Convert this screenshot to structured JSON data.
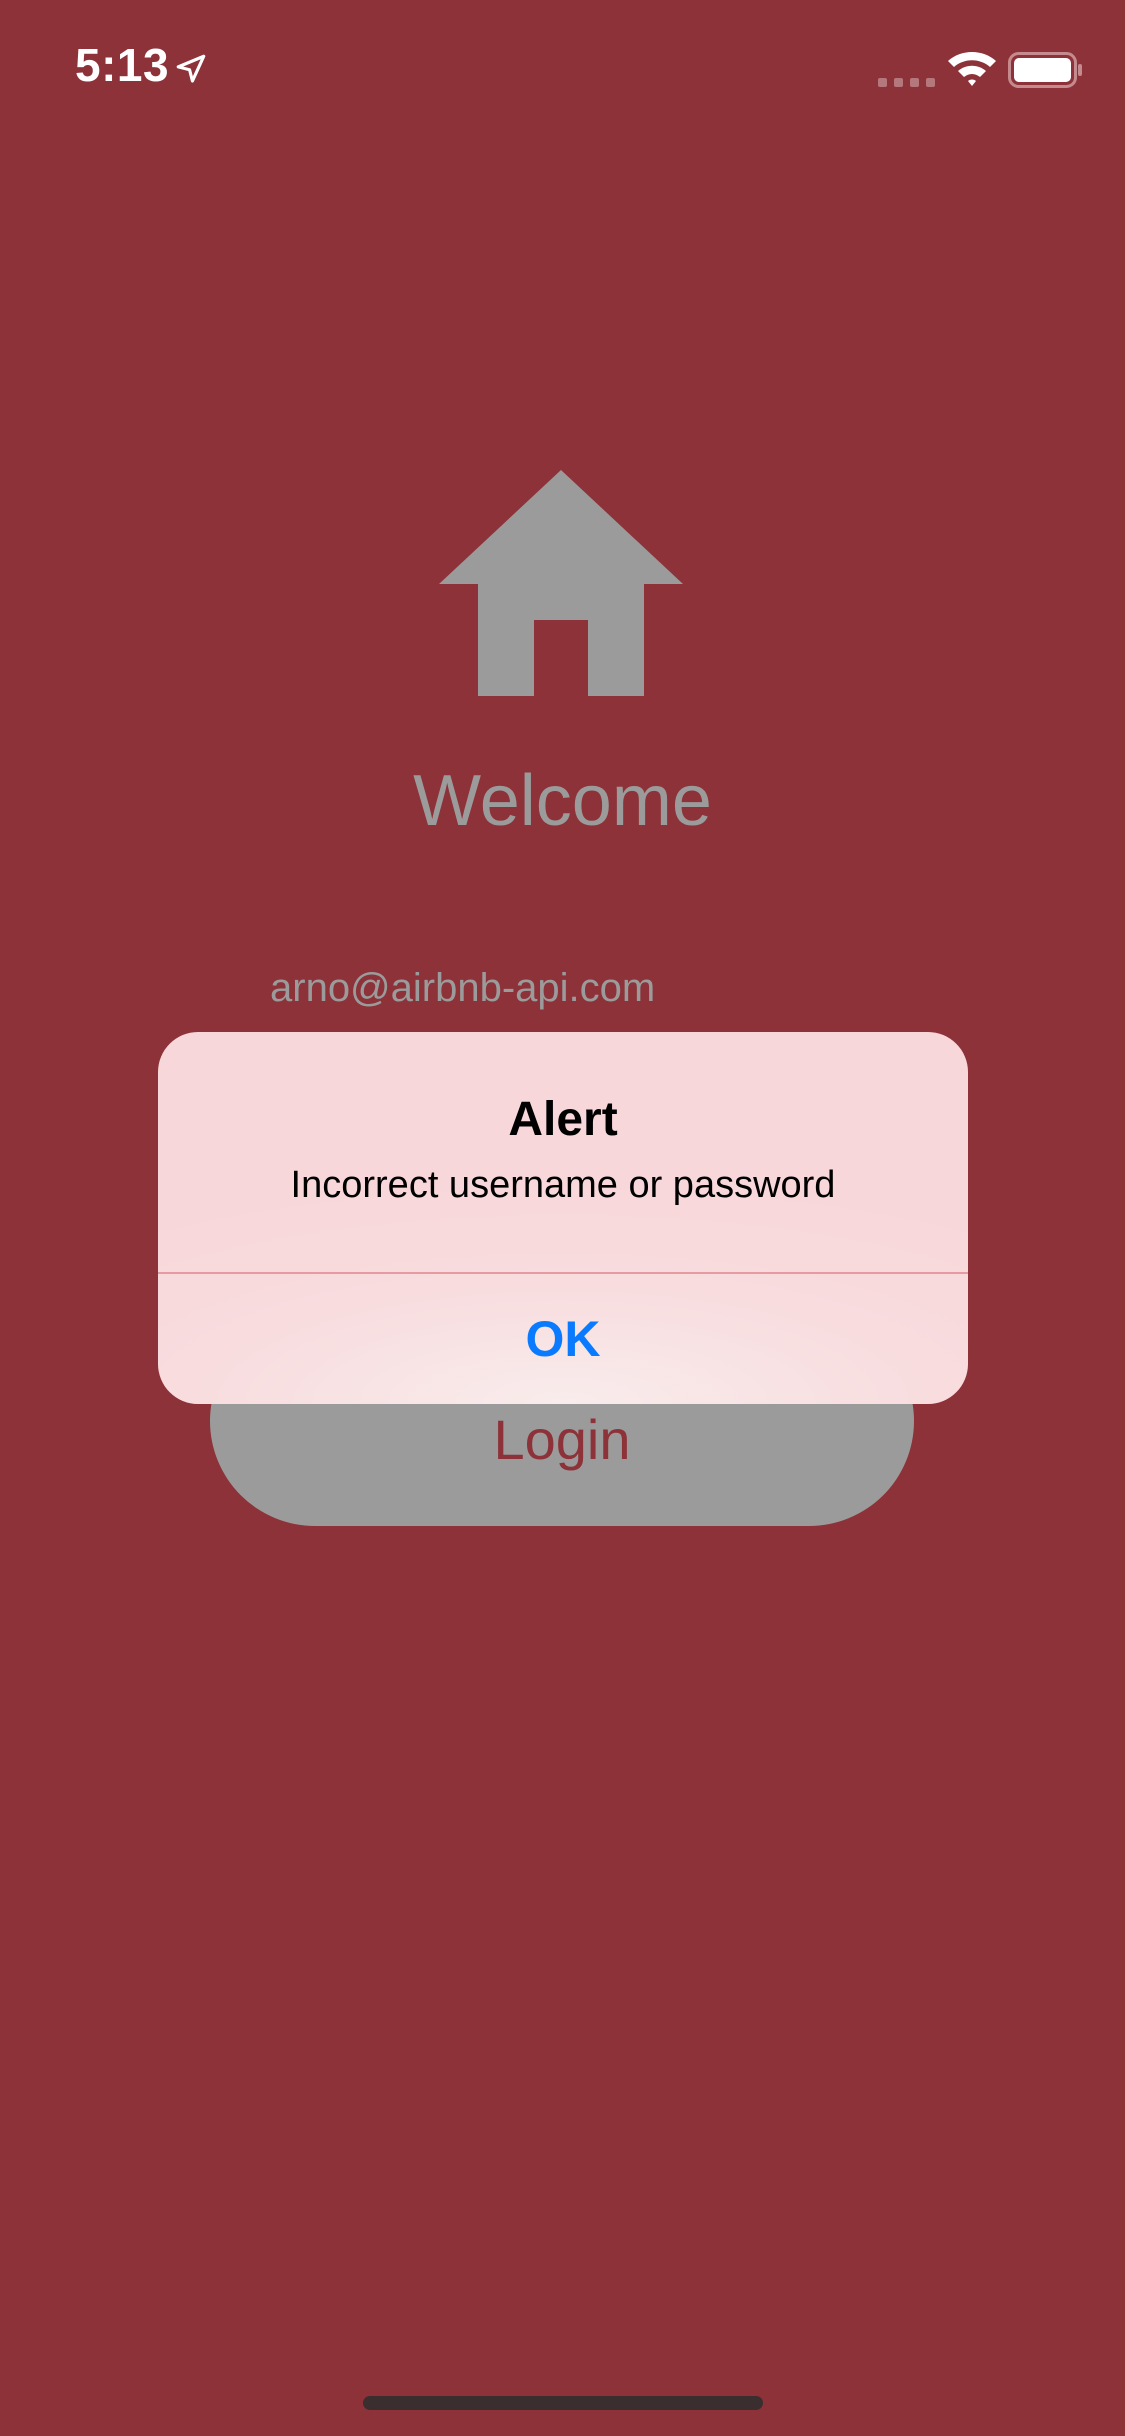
{
  "status_bar": {
    "time": "5:13",
    "location_icon": "location-arrow-icon",
    "signal_icon": "cellular-signal-icon",
    "wifi_icon": "wifi-icon",
    "battery_icon": "battery-icon"
  },
  "login_screen": {
    "logo_icon": "home-icon",
    "title": "Welcome",
    "email_value": "arno@airbnb-api.com",
    "login_button_label": "Login"
  },
  "alert": {
    "title": "Alert",
    "message": "Incorrect username or password",
    "ok_label": "OK"
  },
  "colors": {
    "background": "#8C3238",
    "muted_gray": "#9B9B9B",
    "alert_background": "#F8D7DA",
    "ok_blue": "#0A7AFF"
  }
}
